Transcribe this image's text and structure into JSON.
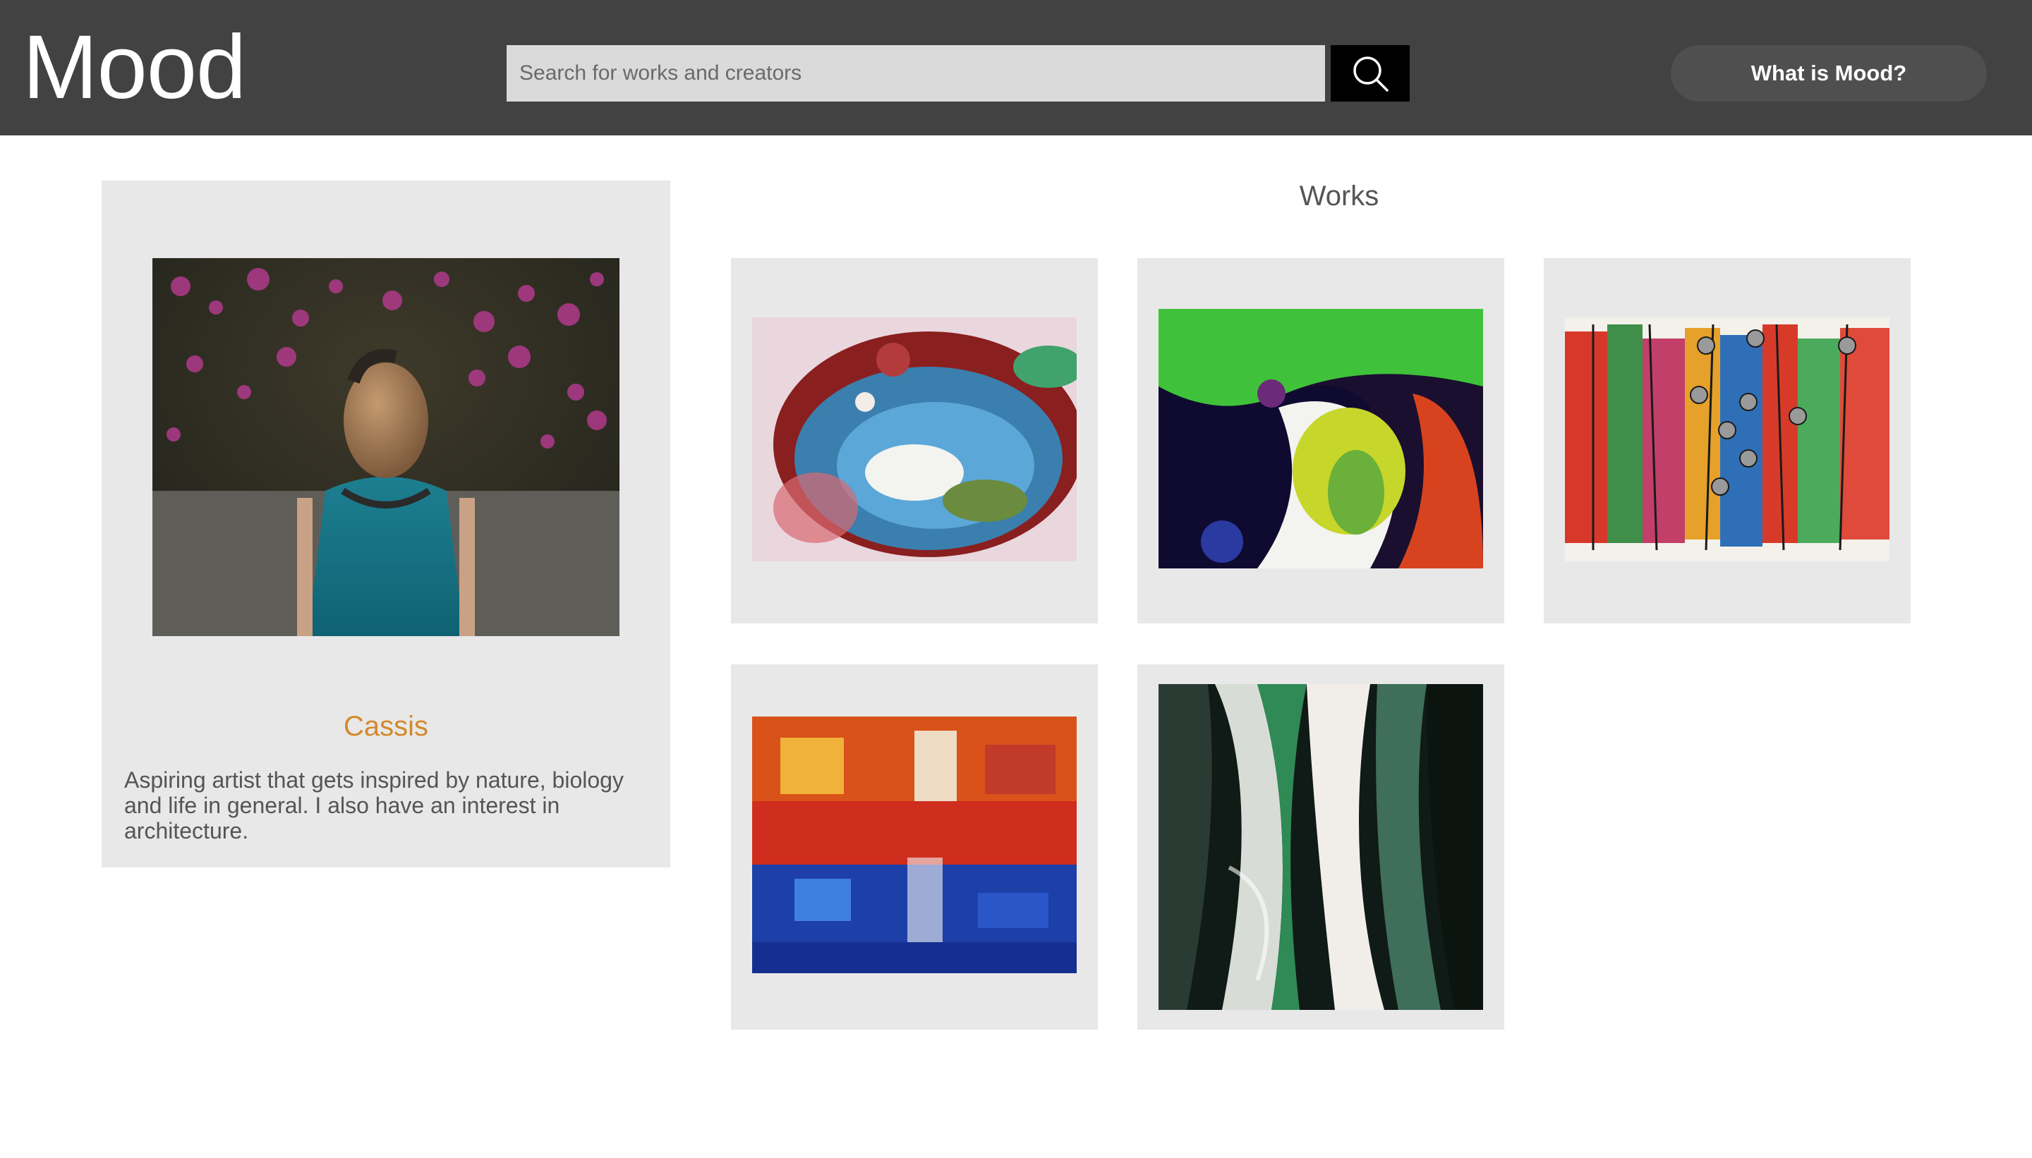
{
  "header": {
    "logo": "Mood",
    "search_placeholder": "Search for works and creators",
    "search_icon": "search-icon",
    "about_label": "What is Mood?"
  },
  "profile": {
    "name": "Cassis",
    "bio": "Aspiring artist that gets inspired by nature, biology and life in general. I also have an interest in architecture."
  },
  "works": {
    "title": "Works"
  },
  "colors": {
    "header_bg": "#424242",
    "card_bg": "#e8e8e8",
    "accent_name": "#d4892a",
    "text_gray": "#555555"
  }
}
